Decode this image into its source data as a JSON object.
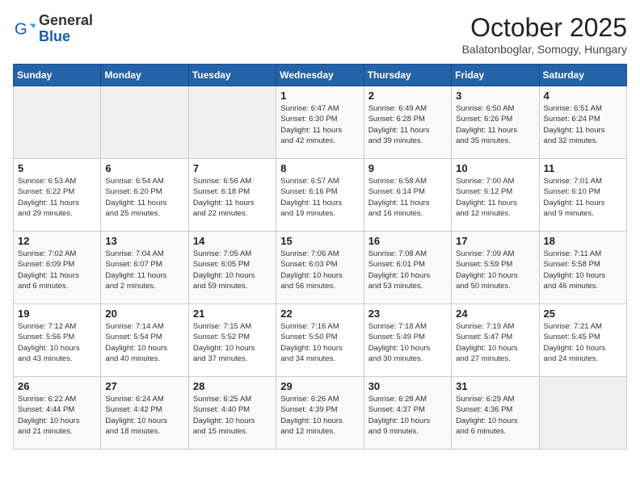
{
  "header": {
    "logo_general": "General",
    "logo_blue": "Blue",
    "month_title": "October 2025",
    "subtitle": "Balatonboglar, Somogy, Hungary"
  },
  "days_of_week": [
    "Sunday",
    "Monday",
    "Tuesday",
    "Wednesday",
    "Thursday",
    "Friday",
    "Saturday"
  ],
  "weeks": [
    [
      {
        "day": "",
        "info": ""
      },
      {
        "day": "",
        "info": ""
      },
      {
        "day": "",
        "info": ""
      },
      {
        "day": "1",
        "info": "Sunrise: 6:47 AM\nSunset: 6:30 PM\nDaylight: 11 hours\nand 42 minutes."
      },
      {
        "day": "2",
        "info": "Sunrise: 6:49 AM\nSunset: 6:28 PM\nDaylight: 11 hours\nand 39 minutes."
      },
      {
        "day": "3",
        "info": "Sunrise: 6:50 AM\nSunset: 6:26 PM\nDaylight: 11 hours\nand 35 minutes."
      },
      {
        "day": "4",
        "info": "Sunrise: 6:51 AM\nSunset: 6:24 PM\nDaylight: 11 hours\nand 32 minutes."
      }
    ],
    [
      {
        "day": "5",
        "info": "Sunrise: 6:53 AM\nSunset: 6:22 PM\nDaylight: 11 hours\nand 29 minutes."
      },
      {
        "day": "6",
        "info": "Sunrise: 6:54 AM\nSunset: 6:20 PM\nDaylight: 11 hours\nand 25 minutes."
      },
      {
        "day": "7",
        "info": "Sunrise: 6:56 AM\nSunset: 6:18 PM\nDaylight: 11 hours\nand 22 minutes."
      },
      {
        "day": "8",
        "info": "Sunrise: 6:57 AM\nSunset: 6:16 PM\nDaylight: 11 hours\nand 19 minutes."
      },
      {
        "day": "9",
        "info": "Sunrise: 6:58 AM\nSunset: 6:14 PM\nDaylight: 11 hours\nand 16 minutes."
      },
      {
        "day": "10",
        "info": "Sunrise: 7:00 AM\nSunset: 6:12 PM\nDaylight: 11 hours\nand 12 minutes."
      },
      {
        "day": "11",
        "info": "Sunrise: 7:01 AM\nSunset: 6:10 PM\nDaylight: 11 hours\nand 9 minutes."
      }
    ],
    [
      {
        "day": "12",
        "info": "Sunrise: 7:02 AM\nSunset: 6:09 PM\nDaylight: 11 hours\nand 6 minutes."
      },
      {
        "day": "13",
        "info": "Sunrise: 7:04 AM\nSunset: 6:07 PM\nDaylight: 11 hours\nand 2 minutes."
      },
      {
        "day": "14",
        "info": "Sunrise: 7:05 AM\nSunset: 6:05 PM\nDaylight: 10 hours\nand 59 minutes."
      },
      {
        "day": "15",
        "info": "Sunrise: 7:06 AM\nSunset: 6:03 PM\nDaylight: 10 hours\nand 56 minutes."
      },
      {
        "day": "16",
        "info": "Sunrise: 7:08 AM\nSunset: 6:01 PM\nDaylight: 10 hours\nand 53 minutes."
      },
      {
        "day": "17",
        "info": "Sunrise: 7:09 AM\nSunset: 5:59 PM\nDaylight: 10 hours\nand 50 minutes."
      },
      {
        "day": "18",
        "info": "Sunrise: 7:11 AM\nSunset: 5:58 PM\nDaylight: 10 hours\nand 46 minutes."
      }
    ],
    [
      {
        "day": "19",
        "info": "Sunrise: 7:12 AM\nSunset: 5:56 PM\nDaylight: 10 hours\nand 43 minutes."
      },
      {
        "day": "20",
        "info": "Sunrise: 7:14 AM\nSunset: 5:54 PM\nDaylight: 10 hours\nand 40 minutes."
      },
      {
        "day": "21",
        "info": "Sunrise: 7:15 AM\nSunset: 5:52 PM\nDaylight: 10 hours\nand 37 minutes."
      },
      {
        "day": "22",
        "info": "Sunrise: 7:16 AM\nSunset: 5:50 PM\nDaylight: 10 hours\nand 34 minutes."
      },
      {
        "day": "23",
        "info": "Sunrise: 7:18 AM\nSunset: 5:49 PM\nDaylight: 10 hours\nand 30 minutes."
      },
      {
        "day": "24",
        "info": "Sunrise: 7:19 AM\nSunset: 5:47 PM\nDaylight: 10 hours\nand 27 minutes."
      },
      {
        "day": "25",
        "info": "Sunrise: 7:21 AM\nSunset: 5:45 PM\nDaylight: 10 hours\nand 24 minutes."
      }
    ],
    [
      {
        "day": "26",
        "info": "Sunrise: 6:22 AM\nSunset: 4:44 PM\nDaylight: 10 hours\nand 21 minutes."
      },
      {
        "day": "27",
        "info": "Sunrise: 6:24 AM\nSunset: 4:42 PM\nDaylight: 10 hours\nand 18 minutes."
      },
      {
        "day": "28",
        "info": "Sunrise: 6:25 AM\nSunset: 4:40 PM\nDaylight: 10 hours\nand 15 minutes."
      },
      {
        "day": "29",
        "info": "Sunrise: 6:26 AM\nSunset: 4:39 PM\nDaylight: 10 hours\nand 12 minutes."
      },
      {
        "day": "30",
        "info": "Sunrise: 6:28 AM\nSunset: 4:37 PM\nDaylight: 10 hours\nand 9 minutes."
      },
      {
        "day": "31",
        "info": "Sunrise: 6:29 AM\nSunset: 4:36 PM\nDaylight: 10 hours\nand 6 minutes."
      },
      {
        "day": "",
        "info": ""
      }
    ]
  ]
}
